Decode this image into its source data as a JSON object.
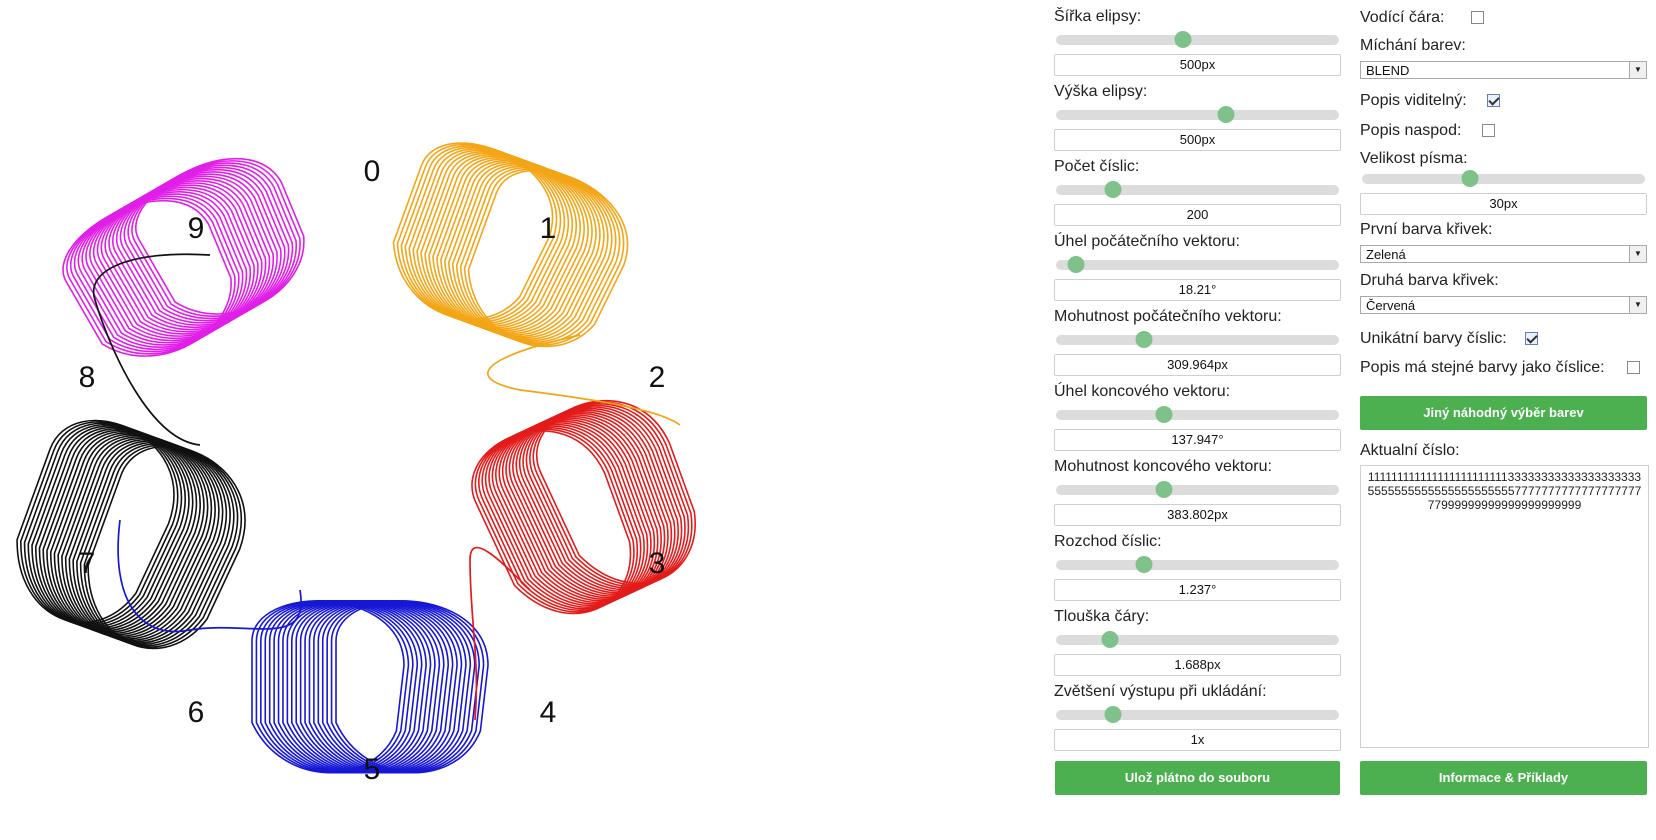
{
  "digits": [
    {
      "label": "0",
      "color": ""
    },
    {
      "label": "1",
      "color": "#f3a516"
    },
    {
      "label": "2",
      "color": ""
    },
    {
      "label": "3",
      "color": "#e31b1b"
    },
    {
      "label": "4",
      "color": ""
    },
    {
      "label": "5",
      "color": "#1717d6"
    },
    {
      "label": "6",
      "color": ""
    },
    {
      "label": "7",
      "color": "#111111"
    },
    {
      "label": "8",
      "color": ""
    },
    {
      "label": "9",
      "color": "#e11ee8"
    }
  ],
  "controls": {
    "ellipse_width": {
      "label": "Šířka elipsy:",
      "value": "500px",
      "level": 0.45
    },
    "ellipse_height": {
      "label": "Výška elipsy:",
      "value": "500px",
      "level": 0.6
    },
    "digit_count": {
      "label": "Počet číslic:",
      "value": "200",
      "level": 0.2
    },
    "start_angle": {
      "label": "Úhel počátečního vektoru:",
      "value": "18.21°",
      "level": 0.07
    },
    "start_magnitude": {
      "label": "Mohutnost počátečního vektoru:",
      "value": "309.964px",
      "level": 0.31
    },
    "end_angle": {
      "label": "Úhel koncového vektoru:",
      "value": "137.947°",
      "level": 0.38
    },
    "end_magnitude": {
      "label": "Mohutnost koncového vektoru:",
      "value": "383.802px",
      "level": 0.38
    },
    "spread": {
      "label": "Rozchod číslic:",
      "value": "1.237°",
      "level": 0.31
    },
    "line_thickness": {
      "label": "Tlouška čáry:",
      "value": "1.688px",
      "level": 0.19
    },
    "export_scale": {
      "label": "Zvětšení výstupu při ukládání:",
      "value": "1x",
      "level": 0.2
    }
  },
  "save_button": "Ulož plátno do souboru",
  "guide_line": {
    "label": "Vodící čára:",
    "checked": false
  },
  "blend": {
    "label": "Míchání barev:",
    "value": "BLEND"
  },
  "caption_visible": {
    "label": "Popis viditelný:",
    "checked": true
  },
  "caption_bottom": {
    "label": "Popis naspod:",
    "checked": false
  },
  "font_size": {
    "label": "Velikost písma:",
    "value": "30px",
    "level": 0.38
  },
  "first_color": {
    "label": "První barva křivek:",
    "value": "Zelená"
  },
  "second_color": {
    "label": "Druhá barva křivek:",
    "value": "Červená"
  },
  "unique_colors": {
    "label": "Unikátní barvy číslic:",
    "checked": true
  },
  "caption_same_colors": {
    "label": "Popis má stejné barvy jako číslice:",
    "checked": false
  },
  "random_colors_button": "Jiný náhodný výběr barev",
  "current_number": {
    "label": "Aktualní číslo:",
    "value": "111111111111111111111111333333333333333333335555555555555555555555777777777777777777777999999999999999999999"
  },
  "info_button": "Informace & Příklady"
}
